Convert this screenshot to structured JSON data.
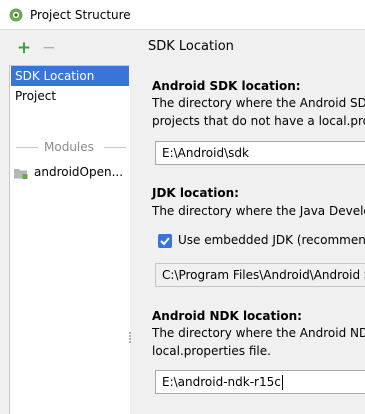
{
  "window": {
    "title": "Project Structure",
    "icon": "android-studio-icon"
  },
  "sidebar": {
    "toolbar": {
      "add_label": "+",
      "remove_label": "−"
    },
    "items": [
      {
        "label": "SDK Location",
        "selected": true
      },
      {
        "label": "Project",
        "selected": false
      }
    ],
    "group_label": "Modules",
    "modules": [
      {
        "label": "androidOpen...",
        "icon": "module-folder-icon"
      }
    ]
  },
  "main": {
    "title": "SDK Location",
    "android_sdk": {
      "label": "Android SDK location:",
      "description_line1": "The directory where the Android SDK i",
      "description_line2": "projects that do not have a local.prope",
      "value": "E:\\Android\\sdk"
    },
    "jdk": {
      "label": "JDK location:",
      "description": "The directory where the Java Developi",
      "checkbox_label": "Use embedded JDK (recommende",
      "checkbox_checked": true,
      "value": "C:\\Program Files\\Android\\Android S"
    },
    "android_ndk": {
      "label": "Android NDK location:",
      "description_line1": "The directory where the Android NDK",
      "description_line2": "local.properties file.",
      "value": "E:\\android-ndk-r15c"
    }
  },
  "colors": {
    "accent": "#3875d6",
    "add_green": "#3d9f3d"
  }
}
